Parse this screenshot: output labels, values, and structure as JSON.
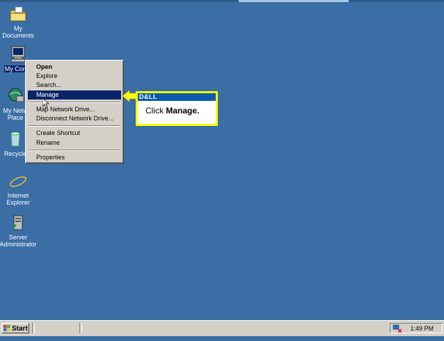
{
  "desktop": {
    "icons": [
      {
        "label": "My Documents",
        "icon": "folder-icon"
      },
      {
        "label": "My Comp",
        "icon": "computer-icon"
      },
      {
        "label": "My Netw Place",
        "icon": "network-icon"
      },
      {
        "label": "Recycle",
        "icon": "recycle-bin-icon"
      },
      {
        "label": "Internet Explorer",
        "icon": "internet-explorer-icon"
      },
      {
        "label": "Server Administrator",
        "icon": "server-admin-icon"
      }
    ],
    "background_color": "#3a6ea5"
  },
  "context_menu": {
    "items": [
      {
        "label": "Open"
      },
      {
        "label": "Explore"
      },
      {
        "label": "Search..."
      },
      {
        "label": "Manage"
      },
      {
        "label": "Map Network Drive..."
      },
      {
        "label": "Disconnect Network Drive..."
      },
      {
        "label": "Create Shortcut"
      },
      {
        "label": "Rename"
      },
      {
        "label": "Properties"
      }
    ],
    "highlighted": "Manage",
    "highlight_color": "#0a246a"
  },
  "callout": {
    "brand": "D&LL",
    "prefix": "Click ",
    "action": "Manage.",
    "border_color": "#ffff00"
  },
  "taskbar": {
    "start_label": "Start",
    "clock": "1:49 PM"
  }
}
